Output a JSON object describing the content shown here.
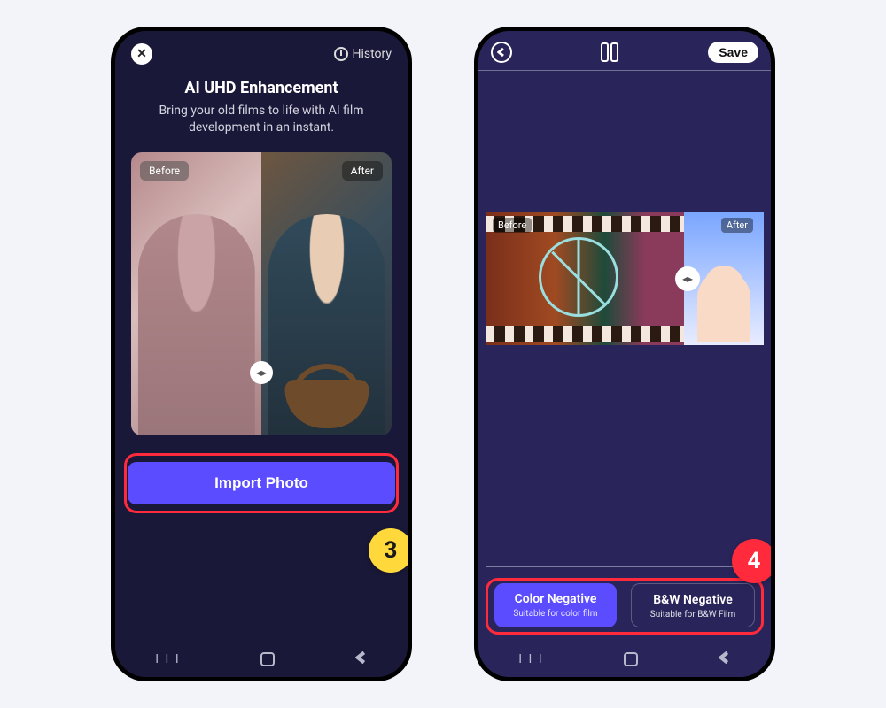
{
  "phone1": {
    "history_label": "History",
    "title": "AI UHD Enhancement",
    "subtitle": "Bring your old films to life with AI film development in an instant.",
    "before_label": "Before",
    "after_label": "After",
    "import_label": "Import Photo",
    "step_badge": "3"
  },
  "phone2": {
    "save_label": "Save",
    "before_label": "Before",
    "after_label": "After",
    "mode_color": {
      "name": "Color Negative",
      "sub": "Suitable for color film"
    },
    "mode_bw": {
      "name": "B&W Negative",
      "sub": "Suitable for B&W Film"
    },
    "step_badge": "4"
  }
}
